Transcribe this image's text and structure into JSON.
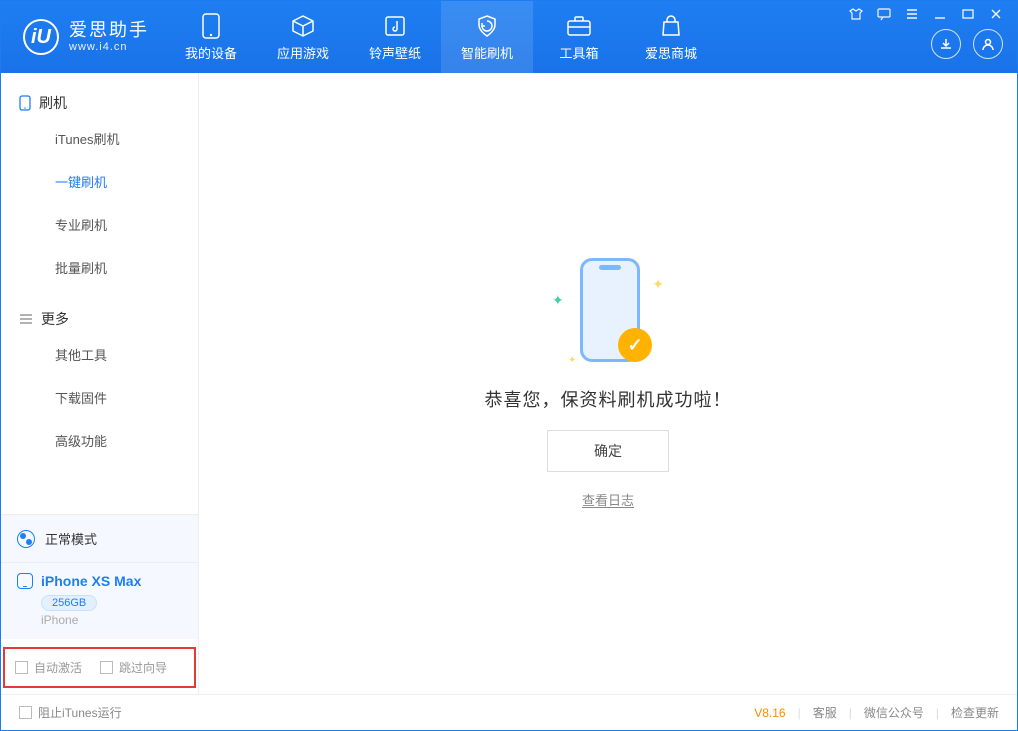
{
  "app": {
    "name": "爱思助手",
    "url": "www.i4.cn"
  },
  "tabs": {
    "device": "我的设备",
    "apps": "应用游戏",
    "ringtone": "铃声壁纸",
    "flash": "智能刷机",
    "toolbox": "工具箱",
    "store": "爱思商城"
  },
  "sidebar": {
    "group_flash": "刷机",
    "items_flash": {
      "itunes": "iTunes刷机",
      "oneclick": "一键刷机",
      "pro": "专业刷机",
      "batch": "批量刷机"
    },
    "group_more": "更多",
    "items_more": {
      "other": "其他工具",
      "firmware": "下载固件",
      "advanced": "高级功能"
    }
  },
  "mode": {
    "label": "正常模式"
  },
  "device": {
    "name": "iPhone XS Max",
    "storage": "256GB",
    "type": "iPhone"
  },
  "options": {
    "auto_activate": "自动激活",
    "skip_guide": "跳过向导"
  },
  "main": {
    "message": "恭喜您，保资料刷机成功啦！",
    "ok": "确定",
    "view_log": "查看日志"
  },
  "footer": {
    "block_itunes": "阻止iTunes运行",
    "version": "V8.16",
    "support": "客服",
    "wechat": "微信公众号",
    "update": "检查更新"
  }
}
